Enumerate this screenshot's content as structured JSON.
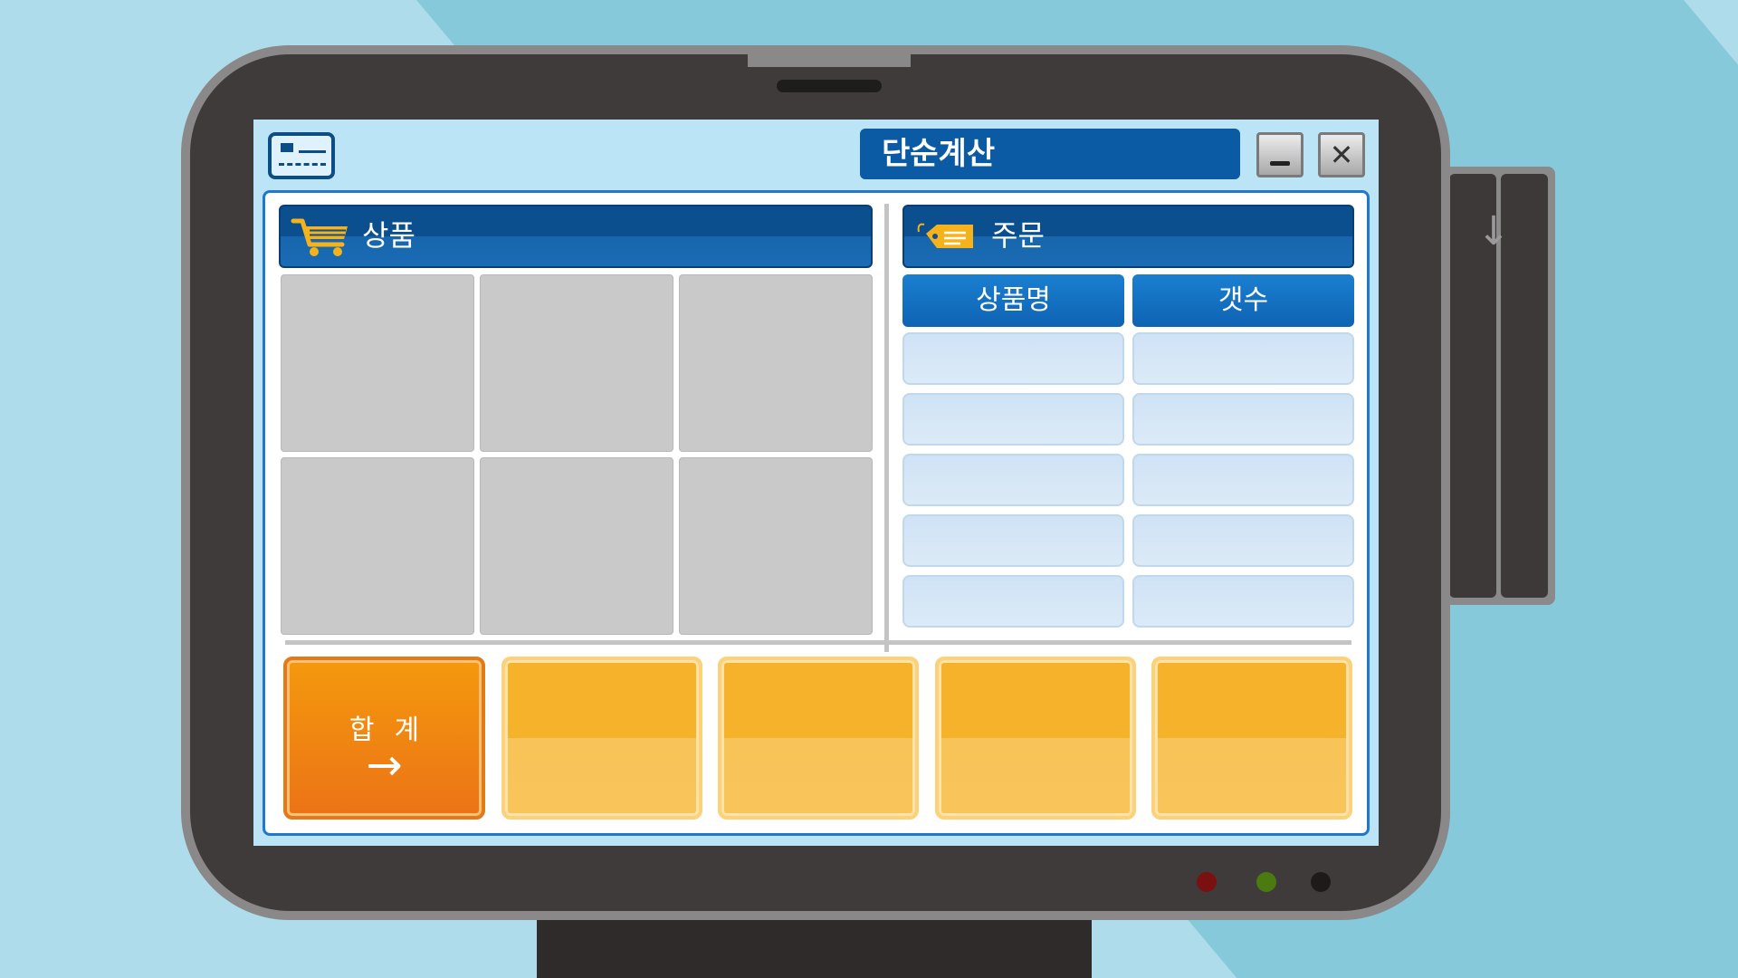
{
  "window": {
    "title": "단순계산",
    "minimize_label": "",
    "close_label": "✕"
  },
  "products": {
    "header": "상품",
    "cells": [
      "",
      "",
      "",
      "",
      "",
      ""
    ]
  },
  "order": {
    "header": "주문",
    "columns": [
      "상품명",
      "갯수"
    ],
    "rows": [
      [
        "",
        ""
      ],
      [
        "",
        ""
      ],
      [
        "",
        ""
      ],
      [
        "",
        ""
      ],
      [
        "",
        ""
      ]
    ]
  },
  "actions": {
    "total_label": "합계",
    "total_arrow": "→",
    "blank_buttons": [
      "",
      "",
      "",
      ""
    ]
  },
  "card_reader": {
    "arrow": "↓"
  },
  "icons": {
    "card": "credit-card-icon",
    "cart": "shopping-cart-icon",
    "tag": "price-tag-icon"
  },
  "colors": {
    "screen_bg": "#bce4f7",
    "header_blue": "#0b4f8f",
    "total_orange": "#ec7316",
    "button_yellow": "#f7b22c"
  }
}
